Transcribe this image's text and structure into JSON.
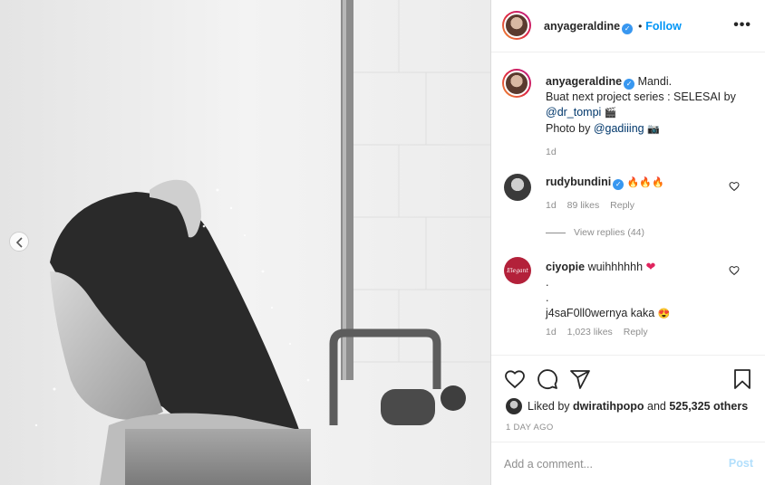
{
  "post": {
    "author": "anyageraldine",
    "follow_label": "Follow",
    "dot": "•",
    "more_label": "•••"
  },
  "caption": {
    "username": "anyageraldine",
    "line1": "Mandi.",
    "line2": "Buat next project series : SELESAI by",
    "mention1": "@dr_tompi",
    "emoji1": "🎬",
    "line3_prefix": "Photo by",
    "mention2": "@gadiiing",
    "emoji2": "📷",
    "time": "1d"
  },
  "comments": [
    {
      "username": "rudybundini",
      "text": "🔥🔥🔥",
      "time": "1d",
      "likes": "89 likes",
      "reply": "Reply",
      "view_replies": "View replies (44)"
    },
    {
      "username": "ciyopie",
      "text": "wuihhhhhh",
      "emoji": "❤",
      "line2": ".",
      "line3": ".",
      "line4": "j4saF0ll0wernya kaka",
      "emoji4": "😍",
      "time": "1d",
      "likes": "1,023 likes",
      "reply": "Reply",
      "avatar_text": "Elegant"
    }
  ],
  "likes_row": {
    "prefix": "Liked by",
    "user": "dwiratihpopo",
    "middle": "and",
    "count": "525,325 others"
  },
  "timestamp": "1 DAY AGO",
  "comment_box": {
    "placeholder": "Add a comment...",
    "post_label": "Post"
  },
  "colors": {
    "accent": "#0095f6",
    "verified": "#3897f0",
    "meta": "#8e8e8e",
    "heart_red": "#ed4956"
  }
}
